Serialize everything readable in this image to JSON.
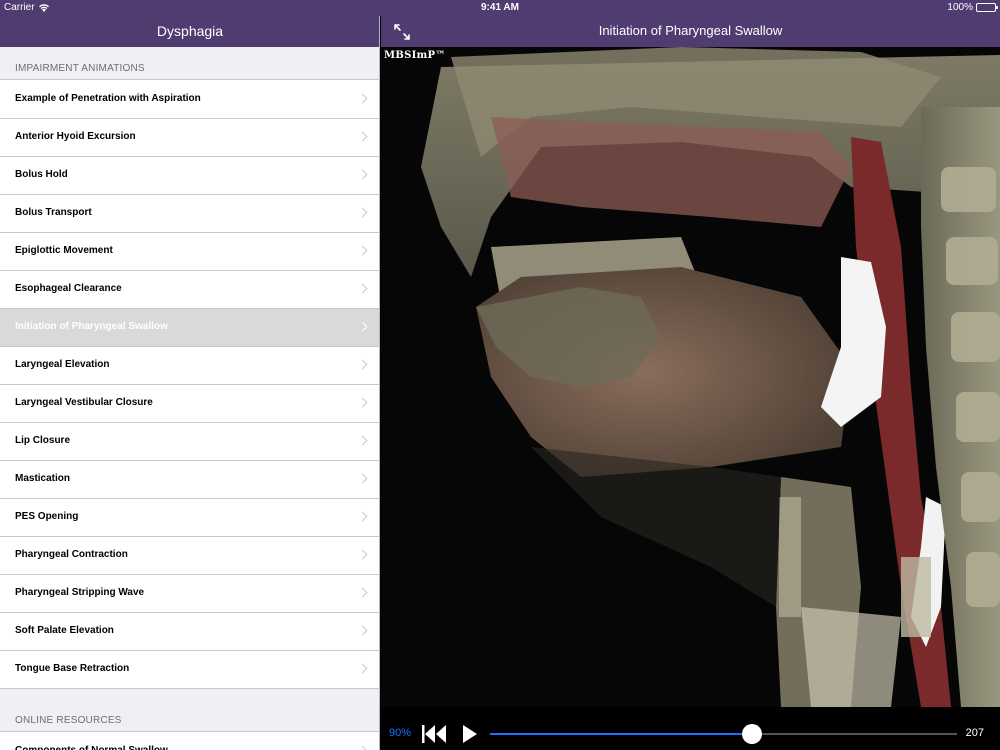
{
  "status": {
    "carrier": "Carrier",
    "time": "9:41 AM",
    "battery": "100%"
  },
  "master": {
    "title": "Dysphagia",
    "sections": [
      {
        "header": "IMPAIRMENT ANIMATIONS",
        "items": [
          "Example of Penetration with Aspiration",
          "Anterior Hyoid Excursion",
          "Bolus Hold",
          "Bolus Transport",
          "Epiglottic Movement",
          "Esophageal Clearance",
          "Initiation of Pharyngeal Swallow",
          "Laryngeal Elevation",
          "Laryngeal Vestibular Closure",
          "Lip Closure",
          "Mastication",
          "PES Opening",
          "Pharyngeal Contraction",
          "Pharyngeal Stripping Wave",
          "Soft Palate Elevation",
          "Tongue Base Retraction"
        ]
      },
      {
        "header": "ONLINE RESOURCES",
        "items": [
          "Components of Normal Swallow"
        ]
      }
    ],
    "selected_item": "Initiation of Pharyngeal Swallow"
  },
  "detail": {
    "title": "Initiation of Pharyngeal Swallow",
    "watermark": "MBSImP™",
    "expand_icon": "expand-arrows-icon"
  },
  "player": {
    "zoom": "90%",
    "frame": "207",
    "progress": 0.56,
    "colors": {
      "accent": "#1a73ff",
      "bar": "#513c71"
    }
  }
}
